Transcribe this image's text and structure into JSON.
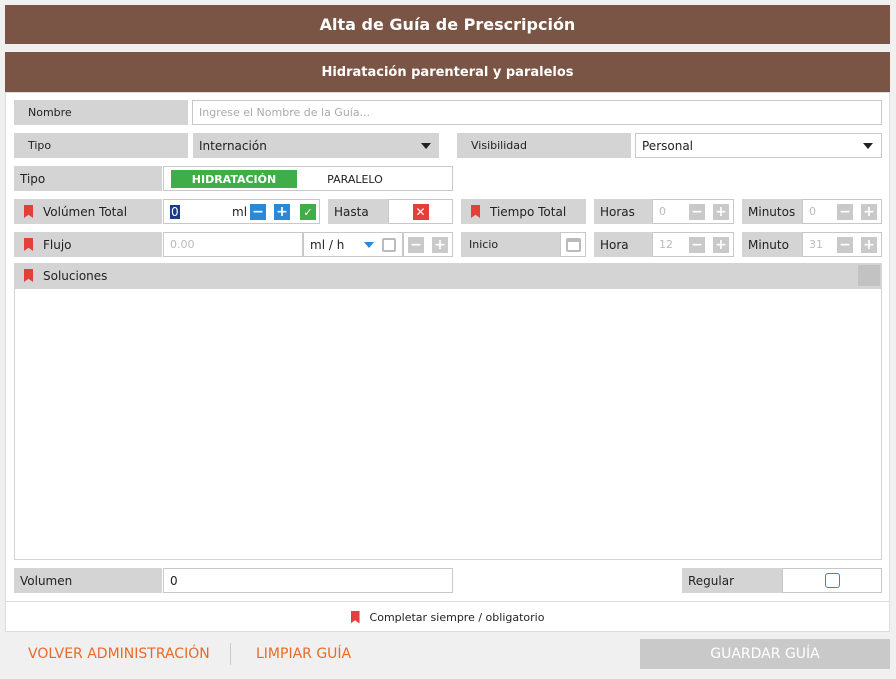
{
  "header": {
    "title": "Alta de Guía de Prescripción"
  },
  "section": {
    "title": "Hidratación parenteral y paralelos"
  },
  "form": {
    "nombre": {
      "label": "Nombre",
      "placeholder": "Ingrese el Nombre de la Guía..."
    },
    "tipo_select": {
      "label": "Tipo",
      "value": "Internación"
    },
    "visibilidad": {
      "label": "Visibilidad",
      "value": "Personal"
    },
    "tipo_toggle": {
      "label": "Tipo",
      "option_a": "HIDRATACIÓN",
      "option_b": "PARALELO"
    },
    "volumen_total": {
      "label": "Volúmen Total",
      "value": "0",
      "unit": "ml"
    },
    "hasta": {
      "label": "Hasta"
    },
    "tiempo_total": {
      "label": "Tiempo Total"
    },
    "horas": {
      "label": "Horas",
      "value": "0"
    },
    "minutos": {
      "label": "Minutos",
      "value": "0"
    },
    "flujo": {
      "label": "Flujo",
      "value": "0.00",
      "unit": "ml / h"
    },
    "inicio": {
      "label": "Inicio"
    },
    "hora": {
      "label": "Hora",
      "value": "12"
    },
    "minuto": {
      "label": "Minuto",
      "value": "31"
    },
    "soluciones": {
      "label": "Soluciones"
    },
    "volumen": {
      "label": "Volumen",
      "value": "0"
    },
    "regular": {
      "label": "Regular"
    },
    "legend": "Completar siempre / obligatorio"
  },
  "footer": {
    "back_label": "VOLVER ADMINISTRACIÓN",
    "clear_label": "LIMPIAR GUÍA",
    "save_label": "GUARDAR GUÍA"
  },
  "colors": {
    "header": "#7a5545",
    "accent_green": "#3fae49",
    "accent_blue": "#2a88d8",
    "accent_red": "#e3403a",
    "link_orange": "#e86a2a"
  }
}
